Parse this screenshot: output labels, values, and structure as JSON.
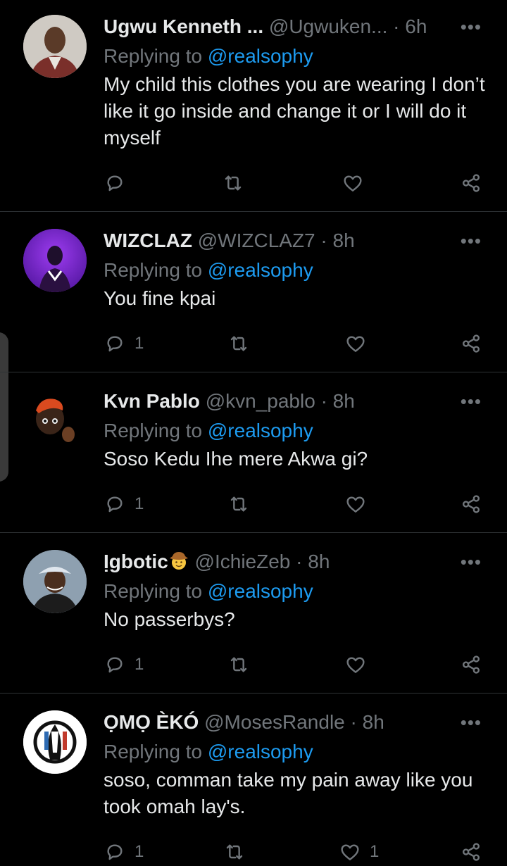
{
  "tweets": [
    {
      "name": "Ugwu Kenneth ...",
      "handle": "@Ugwuken...",
      "time": "· 6h",
      "reply_prefix": "Replying to",
      "reply_to": "@realsophy",
      "text": "My child this clothes you are wearing I don’t like it go inside and change it or I will do it myself",
      "replies": "",
      "retweets": "",
      "likes": "",
      "avatar_bg": "#c9c4bd"
    },
    {
      "name": "WIZCLAZ",
      "handle": "@WIZCLAZ7",
      "time": "· 8h",
      "reply_prefix": "Replying to",
      "reply_to": "@realsophy",
      "text": "You fine kpai",
      "replies": "1",
      "retweets": "",
      "likes": "",
      "avatar_bg": "#7b2bd6"
    },
    {
      "name": "Kvn Pablo",
      "handle": "@kvn_pablo",
      "time": "· 8h",
      "reply_prefix": "Replying to",
      "reply_to": "@realsophy",
      "text": "Soso Kedu Ihe mere Akwa gi?",
      "replies": "1",
      "retweets": "",
      "likes": "",
      "avatar_bg": "#000000"
    },
    {
      "name": "Ịgbotic",
      "name_emoji": "cowboy-hat-face",
      "handle": "@IchieZeb",
      "time": "· 8h",
      "reply_prefix": "Replying to",
      "reply_to": "@realsophy",
      "text": "No passerbys?",
      "replies": "1",
      "retweets": "",
      "likes": "",
      "avatar_bg": "#6e7f8f"
    },
    {
      "name": "ỌMỌ ÈKÓ",
      "handle": "@MosesRandle",
      "time": "· 8h",
      "reply_prefix": "Replying to",
      "reply_to": "@realsophy",
      "text": "soso, comman take my pain away like you took omah lay's.",
      "replies": "1",
      "retweets": "",
      "likes": "1",
      "avatar_bg": "#ffffff"
    }
  ],
  "more_label": "•••",
  "colors": {
    "background": "#000000",
    "primary_text": "#e7e9ea",
    "secondary_text": "#71767b",
    "link": "#1d9bf0",
    "divider": "#2f3336"
  }
}
